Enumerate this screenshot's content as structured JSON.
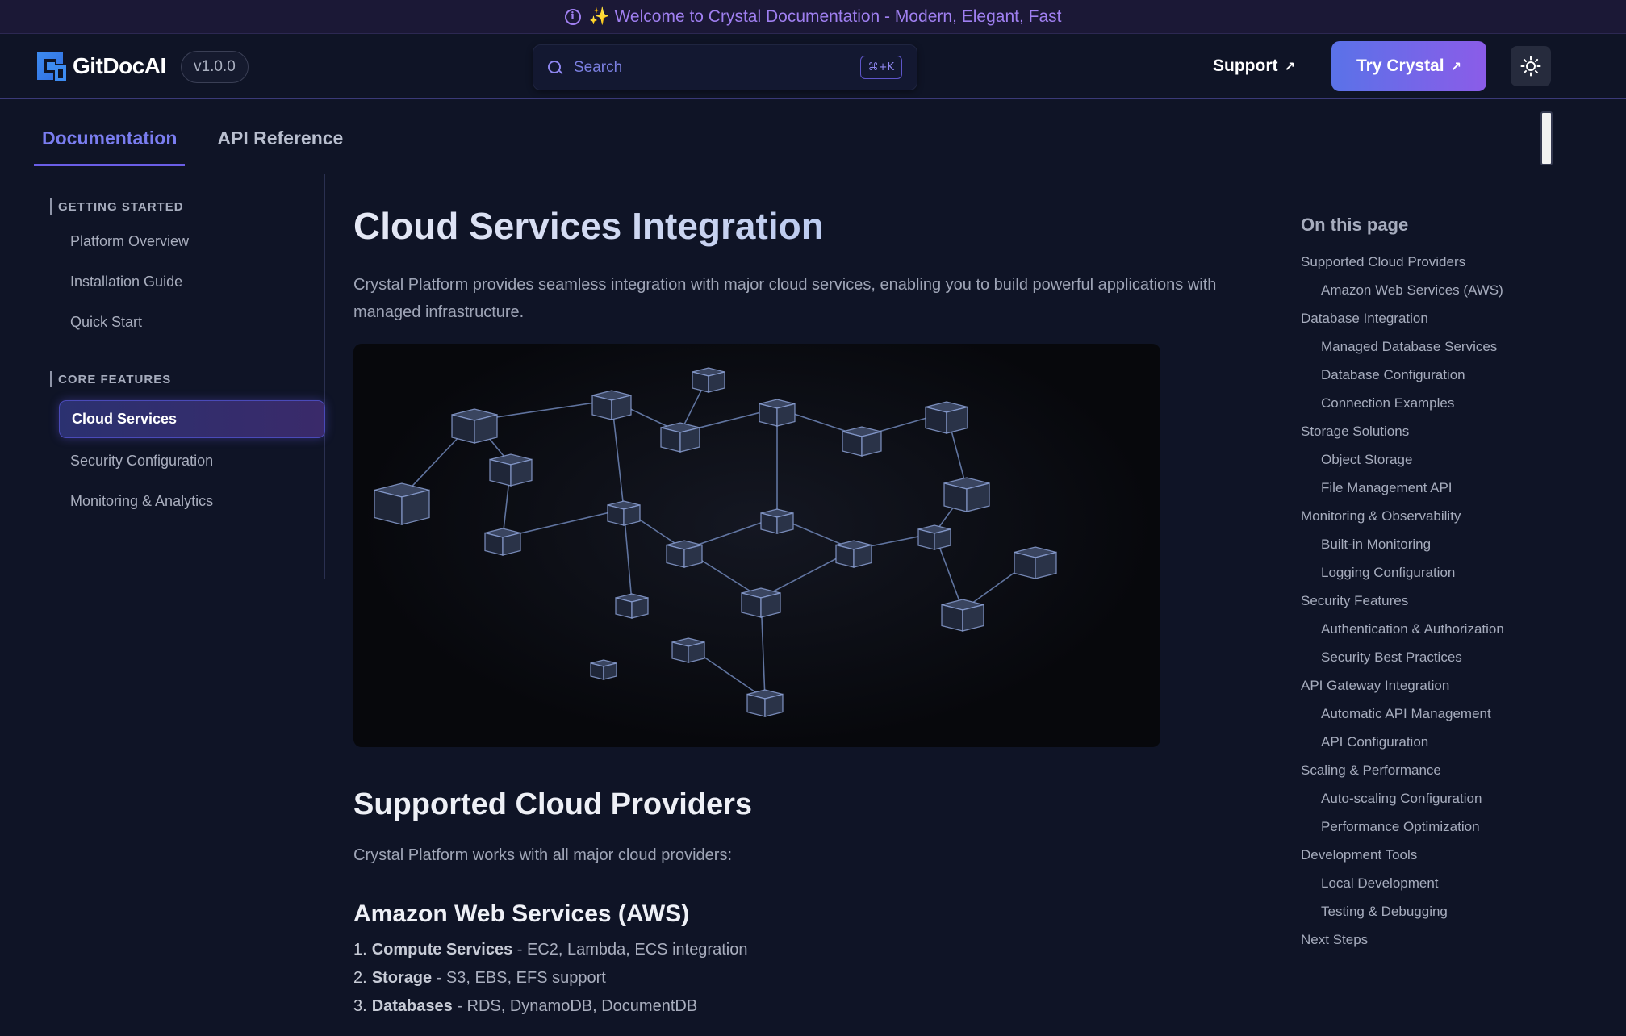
{
  "announcement": {
    "text": "✨ Welcome to Crystal Documentation - Modern, Elegant, Fast"
  },
  "header": {
    "brand": "GitDocAI",
    "version": "v1.0.0",
    "search": {
      "placeholder": "Search",
      "shortcut": "⌘+K"
    },
    "support_label": "Support",
    "cta_label": "Try Crystal",
    "accent_start": "#5a72e8",
    "accent_end": "#8b5ce8"
  },
  "tabs": [
    {
      "label": "Documentation",
      "active": true
    },
    {
      "label": "API Reference",
      "active": false
    }
  ],
  "sidebar": {
    "sections": [
      {
        "title": "GETTING STARTED",
        "items": [
          "Platform Overview",
          "Installation Guide",
          "Quick Start"
        ]
      },
      {
        "title": "CORE FEATURES",
        "items": [
          "Cloud Services",
          "Security Configuration",
          "Monitoring & Analytics"
        ]
      }
    ],
    "active_item": "Cloud Services"
  },
  "main": {
    "title_part1": "Cloud Services ",
    "title_part2": "Integration",
    "intro": "Crystal Platform provides seamless integration with major cloud services, enabling you to build powerful applications with managed infrastructure.",
    "h2": "Supported Cloud Providers",
    "providers_intro": "Crystal Platform works with all major cloud providers:",
    "h3": "Amazon Web Services (AWS)",
    "aws_list": [
      {
        "num": "1.",
        "term": "Compute Services",
        "desc": " - EC2, Lambda, ECS integration"
      },
      {
        "num": "2.",
        "term": "Storage",
        "desc": " - S3, EBS, EFS support"
      },
      {
        "num": "3.",
        "term": "Databases",
        "desc": " - RDS, DynamoDB, DocumentDB"
      }
    ]
  },
  "toc": {
    "title": "On this page",
    "items": [
      {
        "label": "Supported Cloud Providers",
        "level": 1
      },
      {
        "label": "Amazon Web Services (AWS)",
        "level": 2
      },
      {
        "label": "Database Integration",
        "level": 1
      },
      {
        "label": "Managed Database Services",
        "level": 2
      },
      {
        "label": "Database Configuration",
        "level": 2
      },
      {
        "label": "Connection Examples",
        "level": 2
      },
      {
        "label": "Storage Solutions",
        "level": 1
      },
      {
        "label": "Object Storage",
        "level": 2
      },
      {
        "label": "File Management API",
        "level": 2
      },
      {
        "label": "Monitoring & Observability",
        "level": 1
      },
      {
        "label": "Built-in Monitoring",
        "level": 2
      },
      {
        "label": "Logging Configuration",
        "level": 2
      },
      {
        "label": "Security Features",
        "level": 1
      },
      {
        "label": "Authentication & Authorization",
        "level": 2
      },
      {
        "label": "Security Best Practices",
        "level": 2
      },
      {
        "label": "API Gateway Integration",
        "level": 1
      },
      {
        "label": "Automatic API Management",
        "level": 2
      },
      {
        "label": "API Configuration",
        "level": 2
      },
      {
        "label": "Scaling & Performance",
        "level": 1
      },
      {
        "label": "Auto-scaling Configuration",
        "level": 2
      },
      {
        "label": "Performance Optimization",
        "level": 2
      },
      {
        "label": "Development Tools",
        "level": 1
      },
      {
        "label": "Local Development",
        "level": 2
      },
      {
        "label": "Testing & Debugging",
        "level": 2
      },
      {
        "label": "Next Steps",
        "level": 1
      }
    ]
  }
}
